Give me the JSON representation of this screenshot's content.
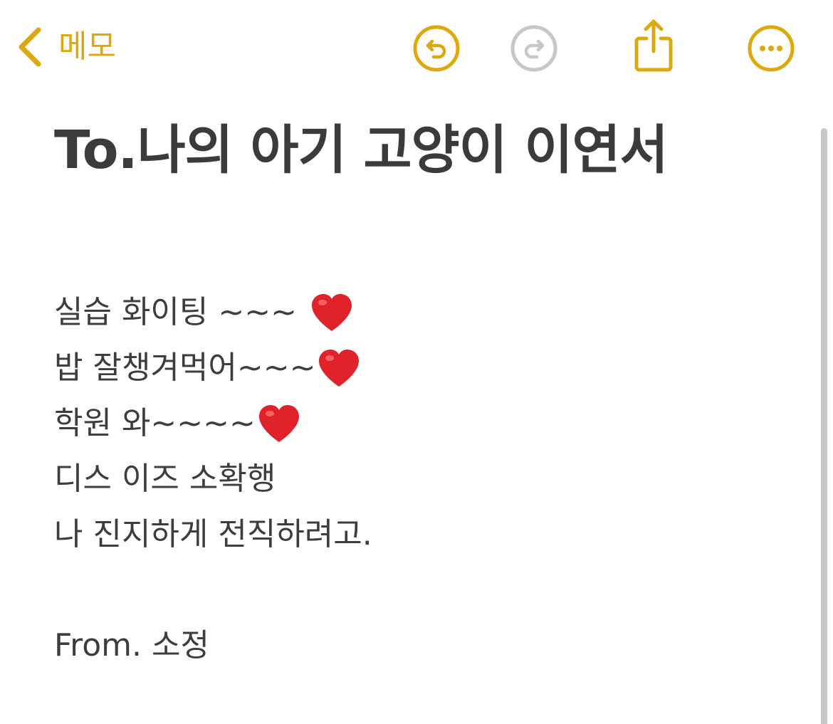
{
  "nav": {
    "back_label": "메모",
    "accent_color": "#DDA90F",
    "disabled_color": "#C7C7C9",
    "icons": {
      "back": "chevron-left-icon",
      "undo": "undo-icon",
      "redo": "redo-icon",
      "share": "share-icon",
      "more": "more-icon"
    }
  },
  "note": {
    "title": "To.나의 아기 고양이 이연서",
    "lines": [
      {
        "text": "실습 화이팅 ~~~",
        "heart": true,
        "heart_spaced": true
      },
      {
        "text": "밥 잘챙겨먹어~~~",
        "heart": true,
        "heart_spaced": false
      },
      {
        "text": "학원 와~~~~",
        "heart": true,
        "heart_spaced": false
      },
      {
        "text": "디스 이즈 소확행",
        "heart": false
      },
      {
        "text": "나 진지하게 전직하려고.",
        "heart": false
      },
      {
        "text": "",
        "heart": false
      },
      {
        "text": "From. 소정",
        "heart": false
      }
    ],
    "heart_color": "#E0222A"
  }
}
